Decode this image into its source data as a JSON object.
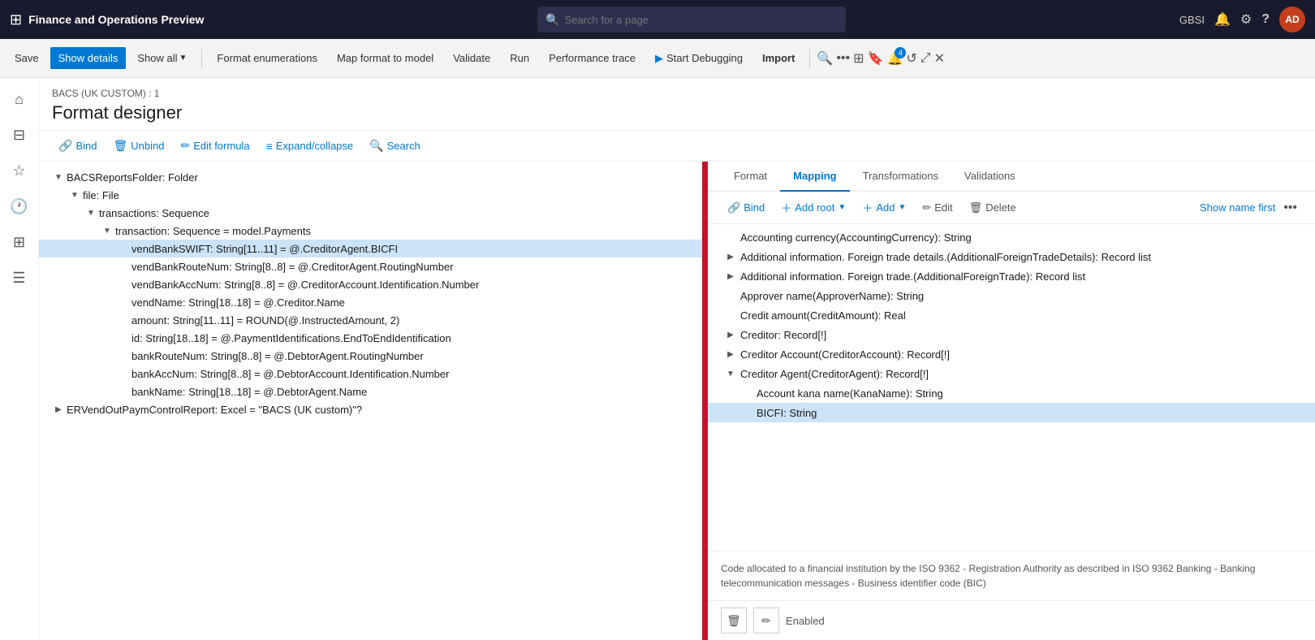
{
  "app": {
    "title": "Finance and Operations Preview",
    "search_placeholder": "Search for a page"
  },
  "topnav_right": {
    "region": "GBSI",
    "avatar_initials": "AD"
  },
  "toolbar": {
    "save_label": "Save",
    "show_details_label": "Show details",
    "show_all_label": "Show all",
    "format_enumerations_label": "Format enumerations",
    "map_format_to_model_label": "Map format to model",
    "validate_label": "Validate",
    "run_label": "Run",
    "performance_trace_label": "Performance trace",
    "start_debugging_label": "Start Debugging",
    "import_label": "Import"
  },
  "breadcrumb": "BACS (UK CUSTOM) : 1",
  "page_title": "Format designer",
  "sub_toolbar": {
    "bind_label": "Bind",
    "unbind_label": "Unbind",
    "edit_formula_label": "Edit formula",
    "expand_collapse_label": "Expand/collapse",
    "search_label": "Search"
  },
  "tree": {
    "items": [
      {
        "level": 0,
        "toggle": "▼",
        "label": "BACSReportsFolder: Folder",
        "selected": false
      },
      {
        "level": 1,
        "toggle": "▼",
        "label": "file: File",
        "selected": false
      },
      {
        "level": 2,
        "toggle": "▼",
        "label": "transactions: Sequence",
        "selected": false
      },
      {
        "level": 3,
        "toggle": "▼",
        "label": "transaction: Sequence = model.Payments",
        "selected": false
      },
      {
        "level": 4,
        "toggle": "",
        "label": "vendBankSWIFT: String[11..11] = @.CreditorAgent.BICFI",
        "selected": true
      },
      {
        "level": 4,
        "toggle": "",
        "label": "vendBankRouteNum: String[8..8] = @.CreditorAgent.RoutingNumber",
        "selected": false
      },
      {
        "level": 4,
        "toggle": "",
        "label": "vendBankAccNum: String[8..8] = @.CreditorAccount.Identification.Number",
        "selected": false
      },
      {
        "level": 4,
        "toggle": "",
        "label": "vendName: String[18..18] = @.Creditor.Name",
        "selected": false
      },
      {
        "level": 4,
        "toggle": "",
        "label": "amount: String[11..11] = ROUND(@.InstructedAmount, 2)",
        "selected": false
      },
      {
        "level": 4,
        "toggle": "",
        "label": "id: String[18..18] = @.PaymentIdentifications.EndToEndIdentification",
        "selected": false
      },
      {
        "level": 4,
        "toggle": "",
        "label": "bankRouteNum: String[8..8] = @.DebtorAgent.RoutingNumber",
        "selected": false
      },
      {
        "level": 4,
        "toggle": "",
        "label": "bankAccNum: String[8..8] = @.DebtorAccount.Identification.Number",
        "selected": false
      },
      {
        "level": 4,
        "toggle": "",
        "label": "bankName: String[18..18] = @.DebtorAgent.Name",
        "selected": false
      },
      {
        "level": 0,
        "toggle": "▶",
        "label": "ERVendOutPaymControlReport: Excel = \"BACS (UK custom)\"?",
        "selected": false
      }
    ]
  },
  "mapping": {
    "tabs": [
      {
        "label": "Format",
        "active": false
      },
      {
        "label": "Mapping",
        "active": true
      },
      {
        "label": "Transformations",
        "active": false
      },
      {
        "label": "Validations",
        "active": false
      }
    ],
    "toolbar": {
      "bind_label": "Bind",
      "add_root_label": "Add root",
      "add_label": "Add",
      "edit_label": "Edit",
      "delete_label": "Delete",
      "show_name_first_label": "Show name first"
    },
    "items": [
      {
        "level": 0,
        "toggle": "",
        "label": "Accounting currency(AccountingCurrency): String",
        "selected": false
      },
      {
        "level": 0,
        "toggle": "▶",
        "label": "Additional information. Foreign trade details.(AdditionalForeignTradeDetails): Record list",
        "selected": false
      },
      {
        "level": 0,
        "toggle": "▶",
        "label": "Additional information. Foreign trade.(AdditionalForeignTrade): Record list",
        "selected": false
      },
      {
        "level": 0,
        "toggle": "",
        "label": "Approver name(ApproverName): String",
        "selected": false
      },
      {
        "level": 0,
        "toggle": "",
        "label": "Credit amount(CreditAmount): Real",
        "selected": false
      },
      {
        "level": 0,
        "toggle": "▶",
        "label": "Creditor: Record[!]",
        "selected": false
      },
      {
        "level": 0,
        "toggle": "▶",
        "label": "Creditor Account(CreditorAccount): Record[!]",
        "selected": false
      },
      {
        "level": 0,
        "toggle": "▼",
        "label": "Creditor Agent(CreditorAgent): Record[!]",
        "selected": false
      },
      {
        "level": 1,
        "toggle": "",
        "label": "Account kana name(KanaName): String",
        "selected": false
      },
      {
        "level": 1,
        "toggle": "",
        "label": "BICFI: String",
        "selected": true
      }
    ],
    "description": "Code allocated to a financial institution by the ISO 9362 - Registration Authority as described in ISO 9362 Banking - Banking telecommunication messages - Business identifier code (BIC)",
    "footer": {
      "enabled_label": "Enabled"
    }
  }
}
